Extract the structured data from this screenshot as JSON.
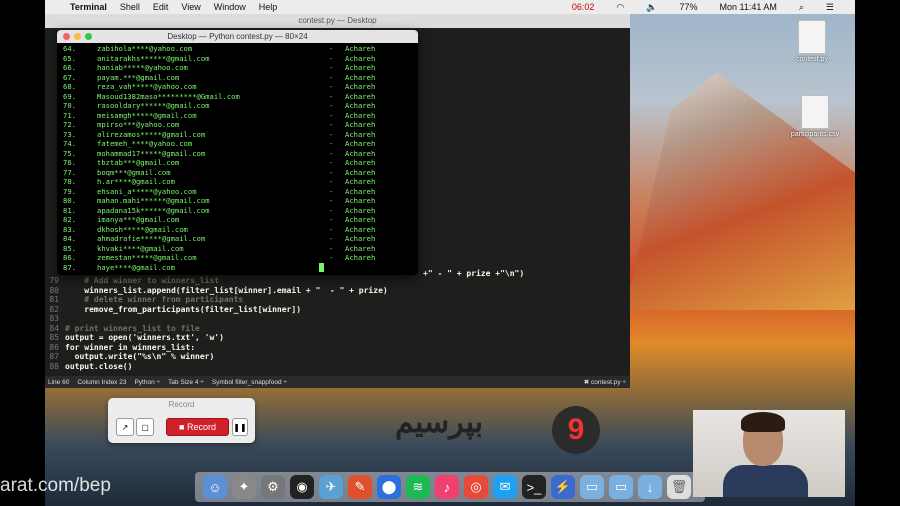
{
  "menubar": {
    "app": "Terminal",
    "items": [
      "Shell",
      "Edit",
      "View",
      "Window",
      "Help"
    ],
    "recording_time": "06:02",
    "battery": "77%",
    "clock": "Mon 11:41 AM"
  },
  "editor": {
    "title": "contest.py — Desktop",
    "code": [
      {
        "n": "79",
        "t": "    # Add winner to winners_list",
        "c": true
      },
      {
        "n": "80",
        "t": "    winners_list.append(filter_list[winner].email + \"  - \" + prize)"
      },
      {
        "n": "81",
        "t": "    # delete winner from participants",
        "c": true
      },
      {
        "n": "82",
        "t": "    remove_from_participants(filter_list[winner])"
      },
      {
        "n": "83",
        "t": ""
      },
      {
        "n": "84",
        "t": "# print winners_list to file",
        "c": true
      },
      {
        "n": "85",
        "t": "output = open('winners.txt', 'w')"
      },
      {
        "n": "86",
        "t": "for winner in winners_list:"
      },
      {
        "n": "87",
        "t": "  output.write(\"%s\\n\" % winner)"
      },
      {
        "n": "88",
        "t": "output.close()"
      }
    ],
    "partial_line": "+\"  -  \" + prize +\"\\n\")",
    "status": {
      "line": "Line 60",
      "column": "Column Index 23",
      "syntax": "Python ÷",
      "tab": "Tab Size 4 ÷",
      "symbol": "Symbol filter_snappfood ÷",
      "file": "✖ contest.py ÷"
    }
  },
  "terminal": {
    "title": "Desktop — Python contest.py — 80×24",
    "dash": "-",
    "prize": "Achareh",
    "rows": [
      {
        "n": "64.",
        "e": "zabihola****@yahoo.com"
      },
      {
        "n": "65.",
        "e": "anitarakhs******@gmail.com"
      },
      {
        "n": "66.",
        "e": "haniab*****@yahoo.com"
      },
      {
        "n": "67.",
        "e": "payam.***@gmail.com"
      },
      {
        "n": "68.",
        "e": "reza_vah*****@yahoo.com"
      },
      {
        "n": "69.",
        "e": "Masoud1382maso*********@Gmail.com"
      },
      {
        "n": "70.",
        "e": "rasooldary******@gmail.com"
      },
      {
        "n": "71.",
        "e": "meisamgh*****@gmail.com"
      },
      {
        "n": "72.",
        "e": "mpirso***@yahoo.com"
      },
      {
        "n": "73.",
        "e": "alirezamos*****@gmail.com"
      },
      {
        "n": "74.",
        "e": "fatemeh_****@yahoo.com"
      },
      {
        "n": "75.",
        "e": "mohammad17*****@gmail.com"
      },
      {
        "n": "76.",
        "e": "tbztab***@gmail.com"
      },
      {
        "n": "77.",
        "e": "boqm***@gmail.com"
      },
      {
        "n": "78.",
        "e": "h.ar****@gmail.com"
      },
      {
        "n": "79.",
        "e": "ehsani_a*****@yahoo.com"
      },
      {
        "n": "80.",
        "e": "mahan.mahi******@gmail.com"
      },
      {
        "n": "81.",
        "e": "apadana15k******@gmail.com"
      },
      {
        "n": "82.",
        "e": "imanya***@gmail.com"
      },
      {
        "n": "83.",
        "e": "dkhosh*****@gmail.com"
      },
      {
        "n": "84.",
        "e": "ahmadrafie*****@gmail.com"
      },
      {
        "n": "85.",
        "e": "khvaki****@gmail.com"
      },
      {
        "n": "86.",
        "e": "zemestan*****@gmail.com"
      },
      {
        "n": "87.",
        "e": "haye****@gmail.com",
        "last": true
      }
    ]
  },
  "record": {
    "title": "Record",
    "button": "Record"
  },
  "desktop": {
    "icons": [
      "contest.py",
      "participants.csv"
    ]
  },
  "logo": {
    "text": "بپرسیم",
    "badge": "9"
  },
  "watermark": "arat.com/bep",
  "colors": {
    "terminal_text": "#7cf56e",
    "record": "#d0202a"
  }
}
